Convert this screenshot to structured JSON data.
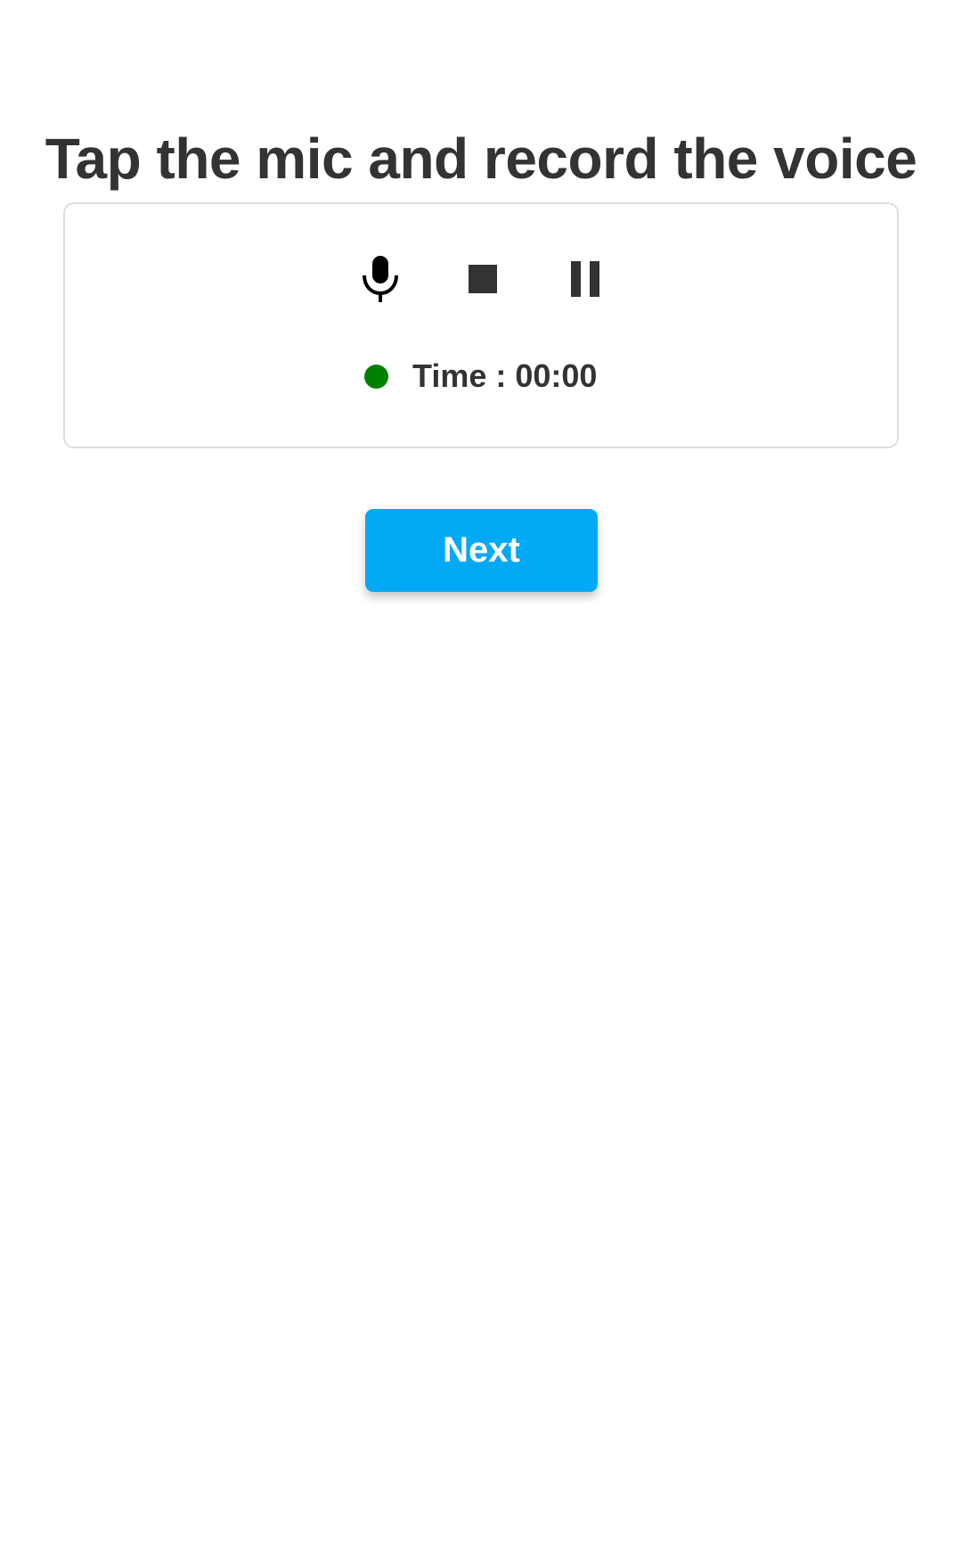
{
  "page": {
    "title": "Tap the mic and record the voice"
  },
  "recorder": {
    "icons": {
      "mic": "microphone-icon",
      "stop": "stop-icon",
      "pause": "pause-icon"
    },
    "status_color": "#008000",
    "time_label": "Time : 00:00"
  },
  "actions": {
    "next_label": "Next",
    "next_color": "#03a9f4"
  },
  "colors": {
    "text": "#333333",
    "border": "#dddddd",
    "background": "#ffffff"
  }
}
